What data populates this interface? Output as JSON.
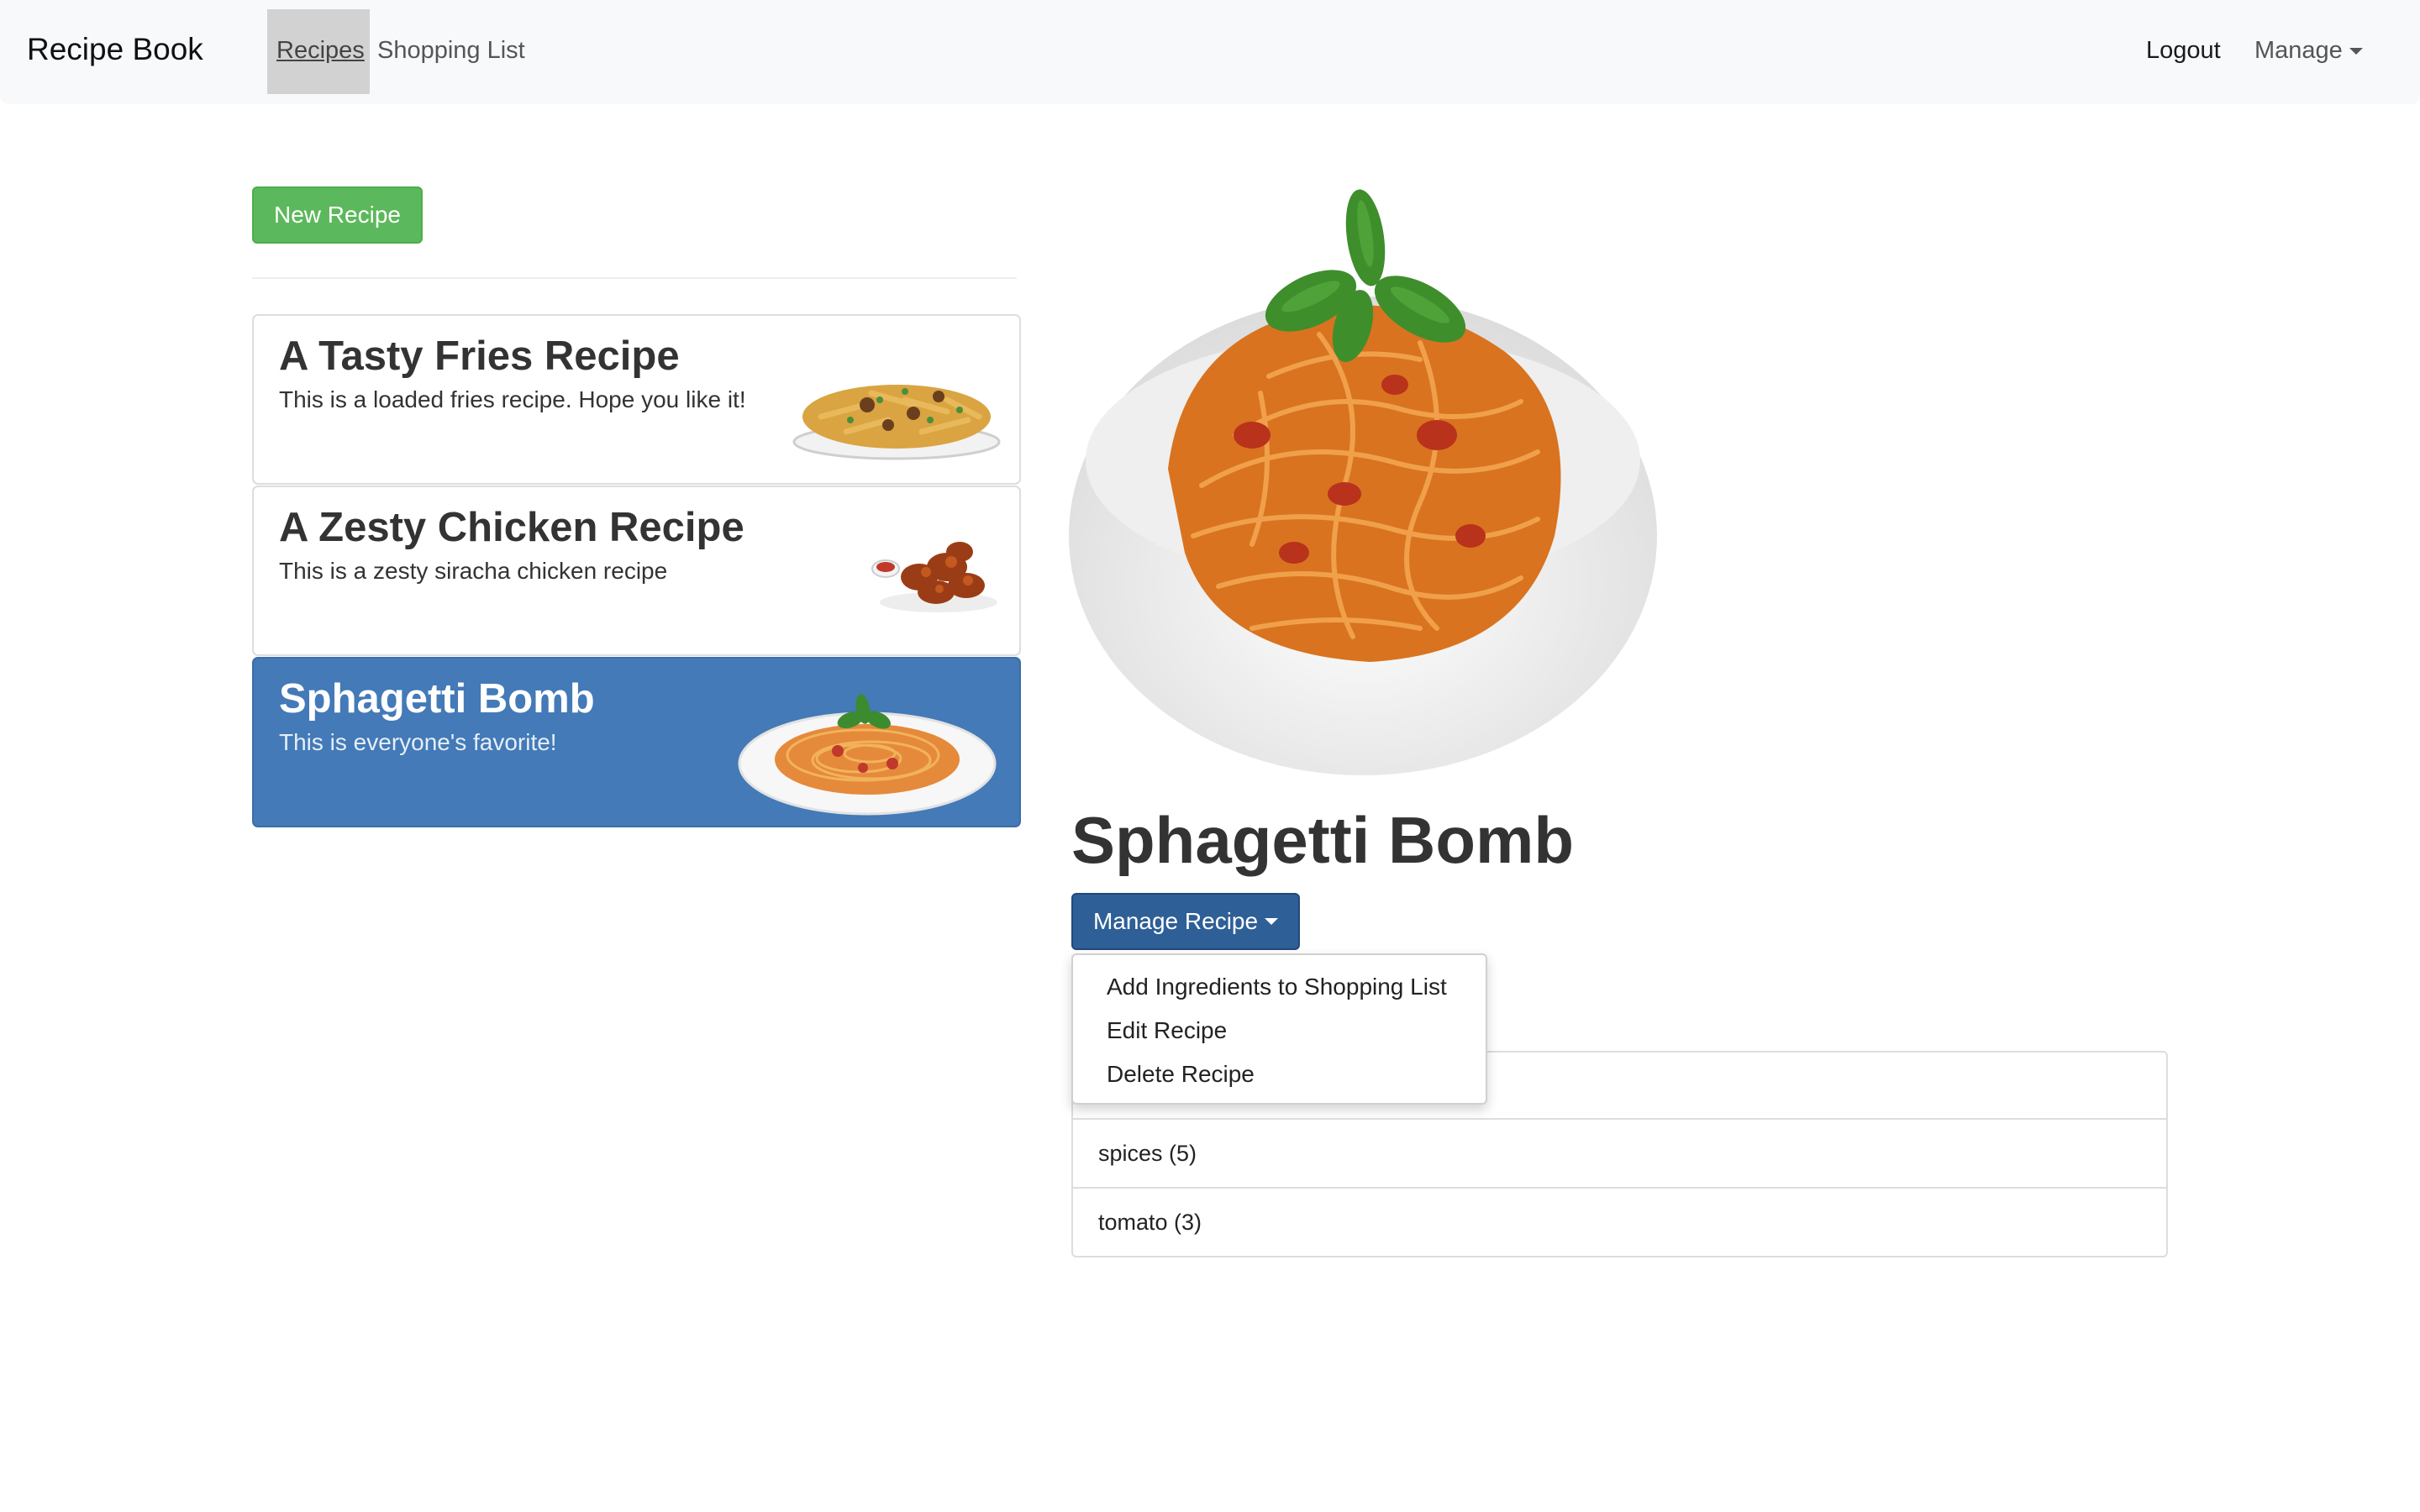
{
  "navbar": {
    "brand": "Recipe Book",
    "links": [
      {
        "label": "Recipes",
        "active": true
      },
      {
        "label": "Shopping List",
        "active": false
      }
    ],
    "right": {
      "logout": "Logout",
      "manage": "Manage"
    }
  },
  "sidebar": {
    "new_recipe_label": "New Recipe",
    "recipes": [
      {
        "name": "A Tasty Fries Recipe",
        "description": "This is a loaded fries recipe. Hope you like it!",
        "image": "loaded-fries-photo",
        "selected": false
      },
      {
        "name": "A Zesty Chicken Recipe",
        "description": "This is a zesty siracha chicken recipe",
        "image": "chicken-wings-photo",
        "selected": false
      },
      {
        "name": "Sphagetti Bomb",
        "description": "This is everyone's favorite!",
        "image": "spaghetti-photo",
        "selected": true
      }
    ]
  },
  "detail": {
    "image": "spaghetti-bowl-photo",
    "title": "Sphagetti Bomb",
    "manage_label": "Manage Recipe",
    "dropdown": {
      "open": true,
      "items": [
        "Add Ingredients to Shopping List",
        "Edit Recipe",
        "Delete Recipe"
      ]
    },
    "ingredients": [
      "",
      "spices (5)",
      "tomato (3)"
    ]
  },
  "colors": {
    "navbar_bg": "#f8f9fa",
    "new_button": "#5cb85c",
    "active_card": "#437ab7",
    "manage_button": "#2e5f96"
  }
}
